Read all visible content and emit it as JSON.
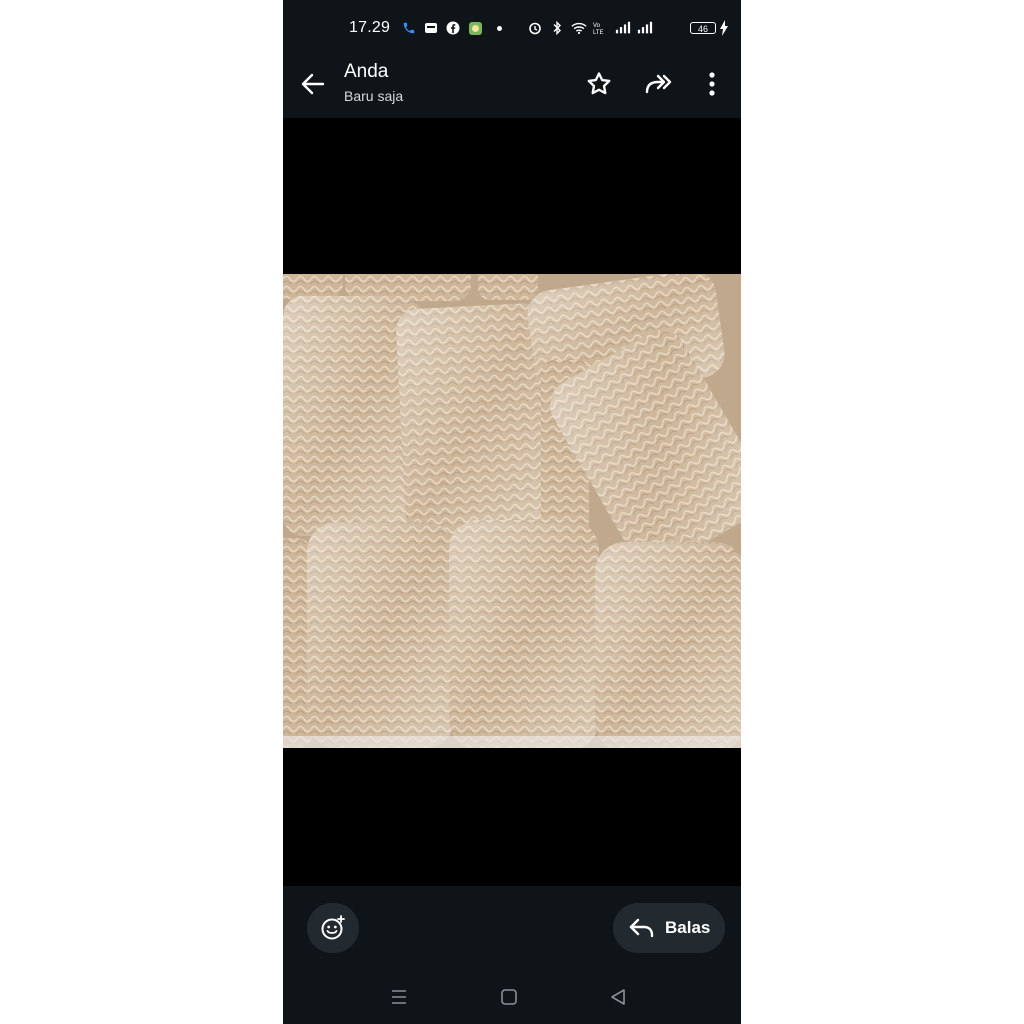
{
  "status_bar": {
    "time": "17.29",
    "battery_level": "46",
    "icons": [
      "phone-call-icon",
      "banking-app-icon",
      "facebook-icon",
      "app-icon",
      "alarm-icon",
      "bluetooth-icon",
      "wifi-icon",
      "volte-icon",
      "signal-icon",
      "signal-icon-2",
      "battery-icon",
      "charging-icon"
    ]
  },
  "header": {
    "title": "Anda",
    "subtitle": "Baru saja"
  },
  "footer": {
    "reply_label": "Balas"
  },
  "colors": {
    "bar_bg": "#0f1418",
    "button_bg": "#232a2f",
    "viewer_bg": "#000000"
  }
}
